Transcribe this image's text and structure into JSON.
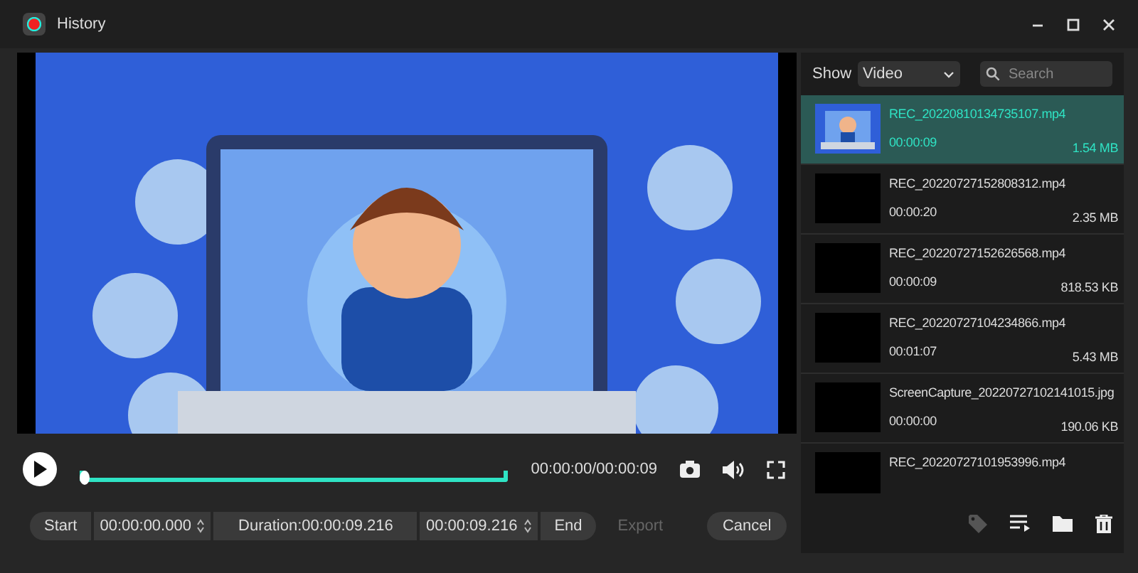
{
  "window": {
    "title": "History"
  },
  "player": {
    "time": "00:00:00/00:00:09",
    "progress": {
      "level": 0
    }
  },
  "trim": {
    "start_label": "Start",
    "start_time": "00:00:00.000",
    "duration": "Duration:00:00:09.216",
    "end_time": "00:00:09.216",
    "end_label": "End"
  },
  "actions": [
    {
      "label": "Export",
      "disabled": true
    },
    {
      "label": "Cancel",
      "disabled": false
    }
  ],
  "filter": {
    "label": "Show",
    "value": "Video"
  },
  "search": {
    "placeholder": "Search"
  },
  "files": [
    {
      "name": "REC_20220810134735107.mp4",
      "duration": "00:00:09",
      "size": "1.54 MB",
      "selected": true,
      "kind": "picture"
    },
    {
      "name": "REC_20220727152808312.mp4",
      "duration": "00:00:20",
      "size": "2.35 MB",
      "selected": false
    },
    {
      "name": "REC_20220727152626568.mp4",
      "duration": "00:00:09",
      "size": "818.53 KB",
      "selected": false
    },
    {
      "name": "REC_20220727104234866.mp4",
      "duration": "00:01:07",
      "size": "5.43 MB",
      "selected": false
    },
    {
      "name": "ScreenCapture_20220727102141015.jpg",
      "duration": "00:00:00",
      "size": "190.06 KB",
      "selected": false
    },
    {
      "name": "REC_20220727101953996.mp4",
      "selected": false
    }
  ]
}
